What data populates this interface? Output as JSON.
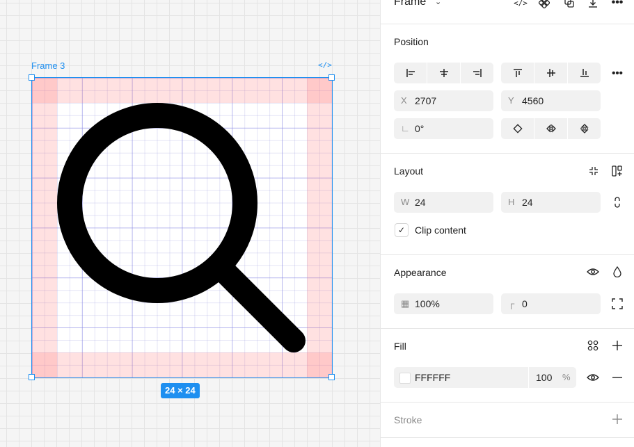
{
  "canvas": {
    "frame_label": "Frame 3",
    "size_badge": "24 × 24"
  },
  "panel": {
    "header": {
      "title": "Frame"
    },
    "position": {
      "title": "Position",
      "x_label": "X",
      "x_value": "2707",
      "y_label": "Y",
      "y_value": "4560",
      "rotation_value": "0°"
    },
    "layout": {
      "title": "Layout",
      "w_label": "W",
      "w_value": "24",
      "h_label": "H",
      "h_value": "24",
      "clip_content_label": "Clip content",
      "clip_content_checked": true
    },
    "appearance": {
      "title": "Appearance",
      "opacity_value": "100%",
      "radius_value": "0"
    },
    "fill": {
      "title": "Fill",
      "hex_value": "FFFFFF",
      "opacity_value": "100",
      "percent_symbol": "%",
      "swatch_color": "#FFFFFF"
    },
    "stroke": {
      "title": "Stroke"
    }
  },
  "colors": {
    "selection": "#1e8ff0",
    "padding": "#ffdddd"
  }
}
